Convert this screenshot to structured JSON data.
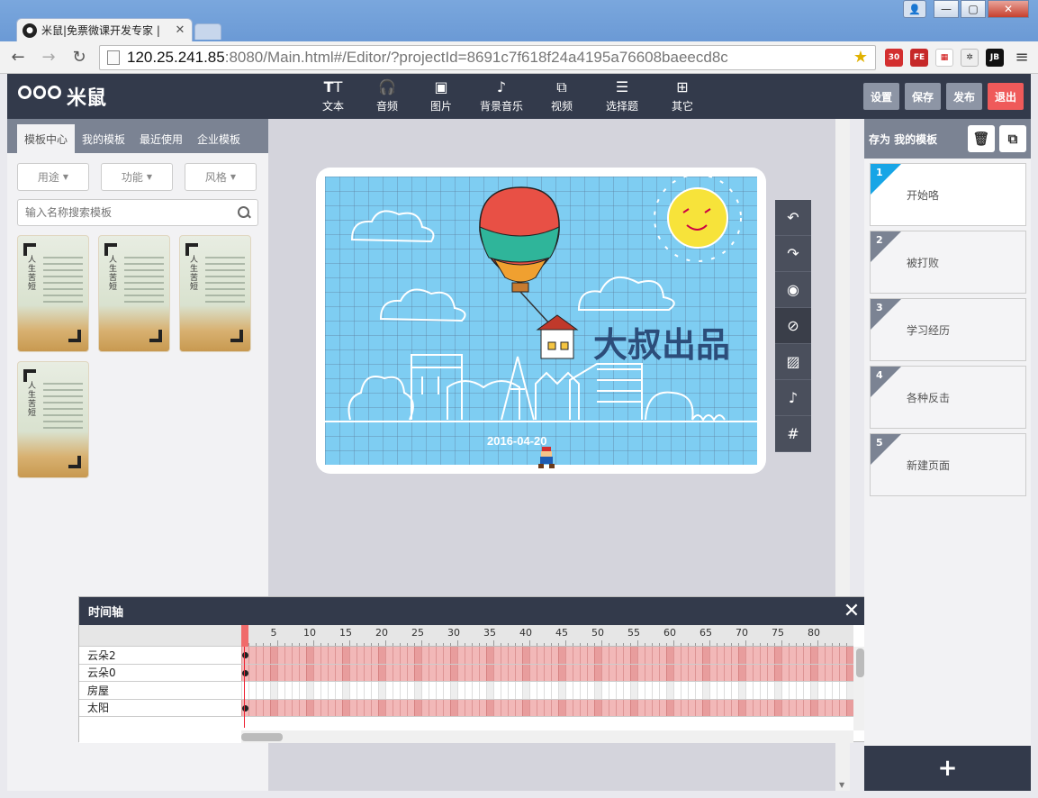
{
  "browser": {
    "tab_title": "米鼠|免票微课开发专家 |",
    "url_host": "120.25.241.85",
    "url_rest": ":8080/Main.html#/Editor/?projectId=8691c7f618f24a4195a76608baeecd8c",
    "extensions": [
      {
        "name": "extension-badge-icon",
        "label": "30"
      },
      {
        "name": "extension-fe-icon",
        "label": "FE"
      },
      {
        "name": "extension-calendar-icon",
        "label": ""
      },
      {
        "name": "extension-bug-icon",
        "label": ""
      },
      {
        "name": "extension-jb-icon",
        "label": "JB"
      }
    ]
  },
  "app": {
    "logo_text": "米鼠",
    "tools": [
      {
        "label": "文本",
        "icon": "text-icon"
      },
      {
        "label": "音频",
        "icon": "headphones-icon"
      },
      {
        "label": "图片",
        "icon": "image-icon"
      },
      {
        "label": "背景音乐",
        "icon": "music-note-icon"
      },
      {
        "label": "视频",
        "icon": "video-icon"
      },
      {
        "label": "选择题",
        "icon": "list-icon"
      },
      {
        "label": "其它",
        "icon": "grid-icon"
      }
    ],
    "actions": {
      "settings": "设置",
      "save": "保存",
      "publish": "发布",
      "exit": "退出"
    }
  },
  "left_panel": {
    "tabs": [
      "模板中心",
      "我的模板",
      "最近使用",
      "企业模板"
    ],
    "active_tab": 0,
    "filters": [
      "用途",
      "功能",
      "风格"
    ],
    "search_placeholder": "输入名称搜索模板",
    "template_title": "人生苦短",
    "template_count": 4
  },
  "stage": {
    "title_text": "大叔出品",
    "date_text": "2016-04-20"
  },
  "side_tools": [
    "undo-icon",
    "redo-icon",
    "eye-icon",
    "eye-off-icon",
    "layer-icon",
    "music-note-icon",
    "grid-icon"
  ],
  "timeline": {
    "title": "时间轴",
    "ruler_labels": [
      "5",
      "10",
      "15",
      "20",
      "25",
      "30",
      "35",
      "40",
      "45",
      "50",
      "55",
      "60",
      "65",
      "70",
      "75",
      "80"
    ],
    "tracks": [
      {
        "name": "云朵2",
        "filled": true
      },
      {
        "name": "云朵0",
        "filled": true
      },
      {
        "name": "房屋",
        "filled": false
      },
      {
        "name": "太阳",
        "filled": true
      }
    ]
  },
  "right_panel": {
    "title": "存为 我的模板",
    "pages": [
      {
        "num": "1",
        "label": "开始咯",
        "active": true
      },
      {
        "num": "2",
        "label": "被打败",
        "active": false
      },
      {
        "num": "3",
        "label": "学习经历",
        "active": false
      },
      {
        "num": "4",
        "label": "各种反击",
        "active": false
      },
      {
        "num": "5",
        "label": "新建页面",
        "active": false
      }
    ],
    "add_label": "+"
  }
}
